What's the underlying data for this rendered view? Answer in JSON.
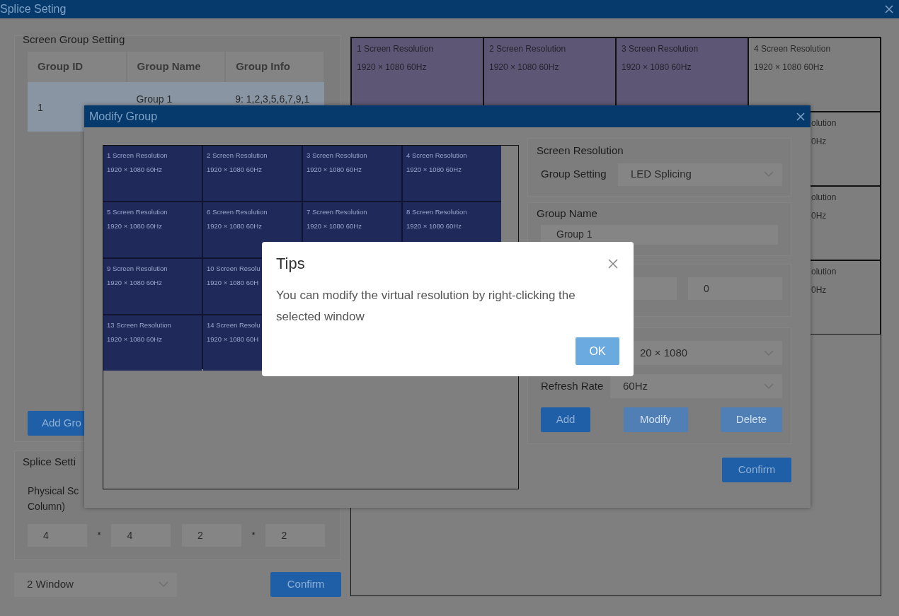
{
  "window": {
    "title": "Splice Seting"
  },
  "screen_group_setting": {
    "title": "Screen Group Setting",
    "columns": [
      "Group ID",
      "Group Name",
      "Group Info"
    ],
    "rows": [
      {
        "cells": [
          "1",
          "Group 1",
          "9: 1,2,3,5,6,7,9,1"
        ],
        "selected": true
      }
    ],
    "add_button": "Add Gro"
  },
  "splice_setting": {
    "title": "Splice Setti",
    "label_lines": [
      "Physical Sc",
      "Column)"
    ],
    "inputs": [
      "4",
      "4",
      "2",
      "2"
    ],
    "separators": [
      "*",
      "*"
    ]
  },
  "window_select": {
    "value": "2 Window"
  },
  "confirm_button": "Confirm",
  "screen_grid": {
    "top_row": [
      {
        "title": "1 Screen Resolution",
        "detail": "1920 × 1080 60Hz",
        "selected": true
      },
      {
        "title": "2 Screen Resolution",
        "detail": "1920 × 1080 60Hz",
        "selected": true
      },
      {
        "title": "3 Screen Resolution",
        "detail": "1920 × 1080 60Hz",
        "selected": true
      },
      {
        "title": "4 Screen Resolution",
        "detail": "1920 × 1080 60Hz",
        "selected": false
      }
    ],
    "right_column": [
      {
        "title": "olution",
        "detail": "0Hz",
        "selected": false
      },
      {
        "title": "olution",
        "detail": "0Hz",
        "selected": false
      },
      {
        "title": "olution",
        "detail": "0Hz",
        "selected": false
      }
    ]
  },
  "modify_dialog": {
    "title": "Modify Group",
    "rows": [
      [
        {
          "title": "1 Screen Resolution",
          "detail": "1920 × 1080 60Hz"
        },
        {
          "title": "2 Screen Resolution",
          "detail": "1920 × 1080 60Hz"
        },
        {
          "title": "3 Screen Resolution",
          "detail": "1920 × 1080 60Hz"
        },
        {
          "title": "4 Screen Resolution",
          "detail": "1920 × 1080 60Hz"
        }
      ],
      [
        {
          "title": "5 Screen Resolution",
          "detail": "1920 × 1080 60Hz"
        },
        {
          "title": "6 Screen Resolution",
          "detail": "1920 × 1080 60Hz"
        },
        {
          "title": "7 Screen Resolution",
          "detail": "1920 × 1080 60Hz"
        },
        {
          "title": "8 Screen Resolution",
          "detail": "1920 × 1080 60Hz"
        }
      ],
      [
        {
          "title": "9 Screen Resolution",
          "detail": "1920 × 1080 60Hz"
        },
        {
          "title": "10 Screen Resolu",
          "detail": "1920 × 1080 60H"
        }
      ],
      [
        {
          "title": "13 Screen Resolution",
          "detail": "1920 × 1080 60Hz"
        },
        {
          "title": "14 Screen Resolu",
          "detail": "1920 × 1080 60H"
        }
      ]
    ],
    "screen_resolution": {
      "title": "Screen Resolution",
      "label": "Group Setting",
      "value": "LED Splicing"
    },
    "group_name": {
      "title": "Group Name",
      "value": "Group 1"
    },
    "offset_value": "0",
    "resolution_value": "20 × 1080",
    "refresh_rate": {
      "label": "Refresh Rate",
      "value": "60Hz"
    },
    "buttons": [
      {
        "label": "Add",
        "disabled": false
      },
      {
        "label": "Modify",
        "disabled": true
      },
      {
        "label": "Delete",
        "disabled": true
      }
    ],
    "confirm_button": "Confirm"
  },
  "tips": {
    "title": "Tips",
    "message": "You can modify the virtual resolution by right-clicking the selected window",
    "ok_button": "OK"
  }
}
